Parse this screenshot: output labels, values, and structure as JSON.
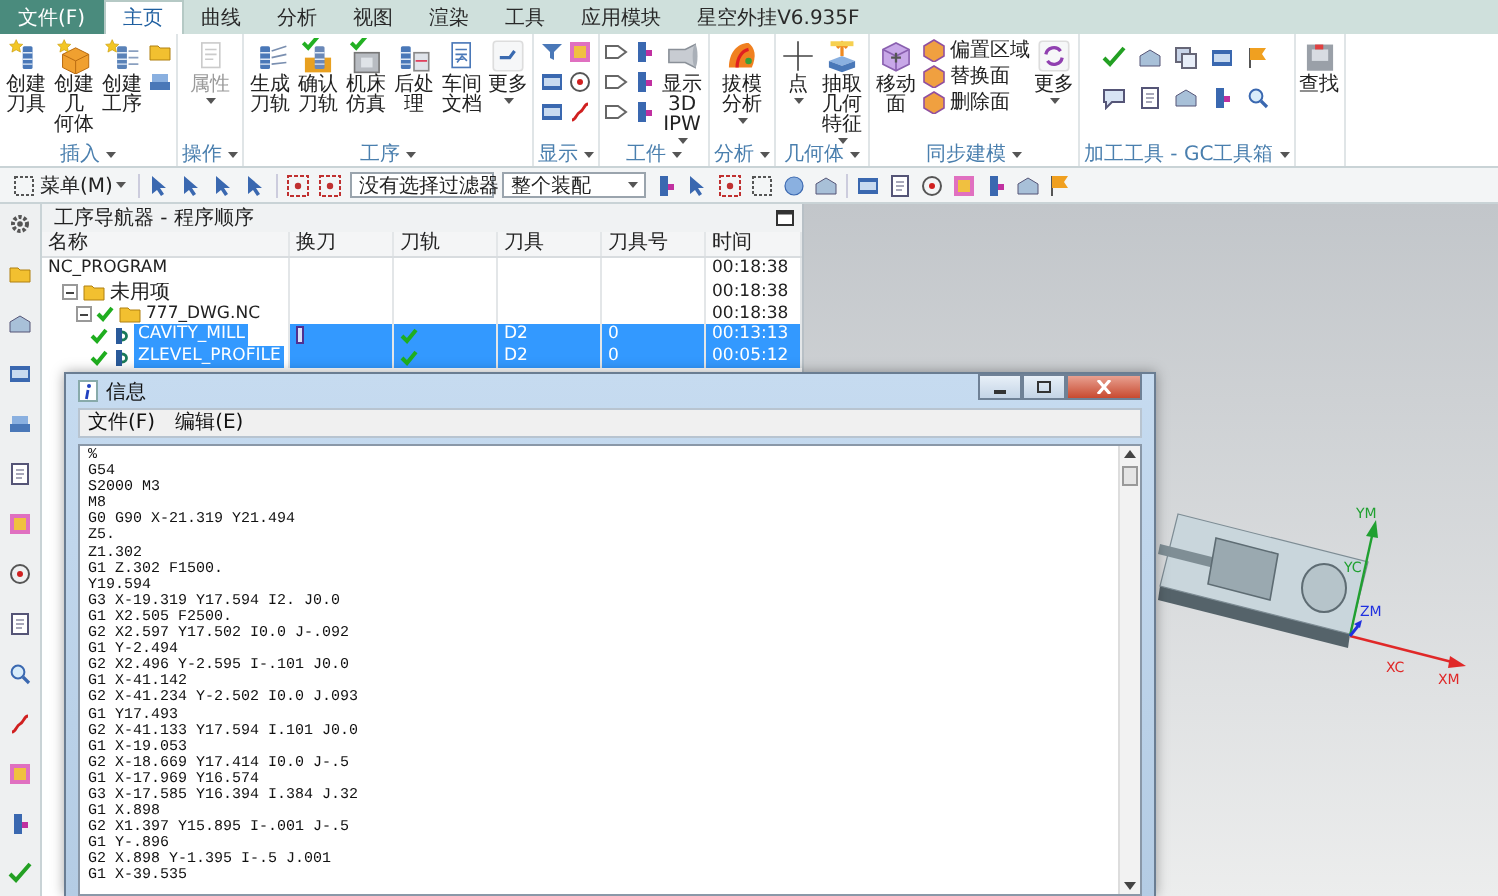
{
  "menu": {
    "file_button": "文件(F)",
    "tabs": [
      {
        "label": "主页",
        "selected": true
      },
      {
        "label": "曲线",
        "selected": false
      },
      {
        "label": "分析",
        "selected": false
      },
      {
        "label": "视图",
        "selected": false
      },
      {
        "label": "渲染",
        "selected": false
      },
      {
        "label": "工具",
        "selected": false
      },
      {
        "label": "应用模块",
        "selected": false
      },
      {
        "label": "星空外挂V6.935F",
        "selected": false
      }
    ]
  },
  "ribbon": {
    "groups": [
      {
        "label": "插入",
        "items": [
          {
            "kind": "large",
            "label": "创建刀具",
            "disabled": false,
            "dropdown": false
          },
          {
            "kind": "large",
            "label": "创建几何体",
            "disabled": false,
            "dropdown": false
          },
          {
            "kind": "large",
            "label": "创建工序",
            "disabled": false,
            "dropdown": false
          }
        ]
      },
      {
        "label": "操作",
        "items": [
          {
            "kind": "large",
            "label": "属性",
            "disabled": true,
            "dropdown": true
          }
        ]
      },
      {
        "label": "工序",
        "items": [
          {
            "kind": "large",
            "label": "生成刀轨",
            "disabled": false,
            "dropdown": false
          },
          {
            "kind": "large",
            "label": "确认刀轨",
            "disabled": false,
            "dropdown": false
          },
          {
            "kind": "large",
            "label": "机床仿真",
            "disabled": false,
            "dropdown": false
          },
          {
            "kind": "large",
            "label": "后处理",
            "disabled": false,
            "dropdown": false
          },
          {
            "kind": "large",
            "label": "车间文档",
            "disabled": false,
            "dropdown": false
          },
          {
            "kind": "large",
            "label": "更多",
            "disabled": false,
            "dropdown": true
          }
        ]
      },
      {
        "label": "显示"
      },
      {
        "label": "工件",
        "items": [
          {
            "kind": "large",
            "label": "显示 3D IPW",
            "disabled": false,
            "dropdown": true
          }
        ]
      },
      {
        "label": "分析",
        "items": [
          {
            "kind": "large",
            "label": "拔模分析",
            "disabled": false,
            "dropdown": true
          }
        ]
      },
      {
        "label": "几何体",
        "items": [
          {
            "kind": "large",
            "label": "点",
            "disabled": false,
            "dropdown": true
          },
          {
            "kind": "large",
            "label": "抽取几何特征",
            "disabled": false,
            "dropdown": true
          }
        ]
      },
      {
        "label": "同步建模",
        "items": [
          {
            "kind": "large",
            "label": "移动面",
            "disabled": false,
            "dropdown": false
          },
          {
            "kind": "list",
            "entries": [
              "偏置区域",
              "替换面",
              "删除面"
            ]
          },
          {
            "kind": "large",
            "label": "更多",
            "disabled": false,
            "dropdown": true
          }
        ]
      },
      {
        "label": "加工工具 - GC工具箱"
      },
      {
        "items": [
          {
            "kind": "large",
            "label": "查找",
            "disabled": false,
            "dropdown": false
          }
        ]
      }
    ]
  },
  "toolbar": {
    "menu_button": "菜单(M)",
    "selection_filters": [
      {
        "value": "没有选择过滤器"
      },
      {
        "value": "整个装配"
      }
    ]
  },
  "navigator": {
    "title": "工序导航器 - 程序顺序",
    "columns": [
      "名称",
      "换刀",
      "刀轨",
      "刀具",
      "刀具号",
      "时间"
    ],
    "rows": [
      {
        "name": "NC_PROGRAM",
        "done": false,
        "selected": false,
        "time": "00:18:38",
        "children": [
          {
            "kind": "group",
            "name": "未用项",
            "expanded": true,
            "done": false,
            "selected": false,
            "time": "00:18:38",
            "children": [
              {
                "kind": "group",
                "name": "777_DWG.NC",
                "expanded": true,
                "done": true,
                "selected": false,
                "time": "00:18:38",
                "children": [
                  {
                    "kind": "operation",
                    "name": "CAVITY_MILL",
                    "done": true,
                    "selected": true,
                    "tool_change": true,
                    "toolpath_ok": true,
                    "tool": "D2",
                    "tool_number": "0",
                    "time": "00:13:13"
                  },
                  {
                    "kind": "operation",
                    "name": "ZLEVEL_PROFILE",
                    "done": true,
                    "selected": true,
                    "tool_change": false,
                    "toolpath_ok": true,
                    "tool": "D2",
                    "tool_number": "0",
                    "time": "00:05:12"
                  }
                ]
              }
            ]
          }
        ]
      }
    ]
  },
  "info_window": {
    "title": "信息",
    "menu": [
      "文件(F)",
      "编辑(E)"
    ],
    "lines": [
      "%",
      "G54",
      "S2000 M3",
      "M8",
      "G0 G90 X-21.319 Y21.494",
      "Z5.",
      "Z1.302",
      "G1 Z.302 F1500.",
      "Y19.594",
      "G3 X-19.319 Y17.594 I2. J0.0",
      "G1 X2.505 F2500.",
      "G2 X2.597 Y17.502 I0.0 J-.092",
      "G1 Y-2.494",
      "G2 X2.496 Y-2.595 I-.101 J0.0",
      "G1 X-41.142",
      "G2 X-41.234 Y-2.502 I0.0 J.093",
      "G1 Y17.493",
      "G2 X-41.133 Y17.594 I.101 J0.0",
      "G1 X-19.053",
      "G2 X-18.669 Y17.414 I0.0 J-.5",
      "G1 X-17.969 Y16.574",
      "G3 X-17.585 Y16.394 I.384 J.32",
      "G1 X.898",
      "G2 X1.397 Y15.895 I-.001 J-.5",
      "G1 Y-.896",
      "G2 X.898 Y-1.395 I-.5 J.001",
      "G1 X-39.535"
    ]
  },
  "viewport": {
    "axis_labels": [
      {
        "label": "YM",
        "color": "#20a030"
      },
      {
        "label": "YC",
        "color": "#20a030"
      },
      {
        "label": "ZM",
        "color": "#2030e0"
      },
      {
        "label": "XC",
        "color": "#e02828"
      },
      {
        "label": "XM",
        "color": "#e02828"
      }
    ]
  }
}
